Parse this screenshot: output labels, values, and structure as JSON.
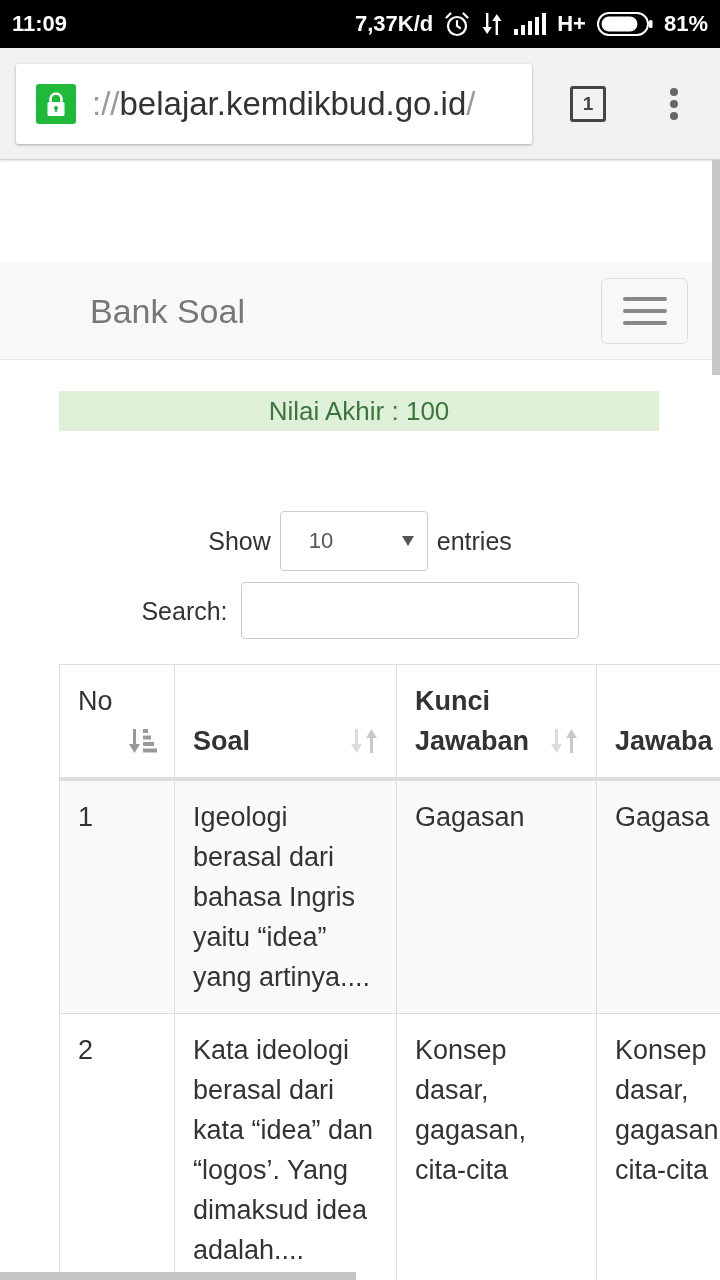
{
  "status_bar": {
    "time": "11:09",
    "network_speed": "7,37K/d",
    "network_type": "H+",
    "battery": "81%"
  },
  "browser": {
    "url": {
      "scheme": "://",
      "host": "belajar.kemdikbud.go.id",
      "path": "/"
    },
    "tab_count": "1"
  },
  "navbar": {
    "brand": "Bank Soal"
  },
  "alert": {
    "text": "Nilai Akhir : 100"
  },
  "length_menu": {
    "label_before": "Show",
    "value": "10",
    "label_after": "entries"
  },
  "search": {
    "label": "Search:"
  },
  "table": {
    "columns": [
      {
        "label": "No",
        "bold": false,
        "sortable": true,
        "sorted": true
      },
      {
        "label": "Soal",
        "bold": true,
        "sortable": true,
        "sorted": false
      },
      {
        "label": "Kunci Jawaban",
        "bold": true,
        "sortable": true,
        "sorted": false
      },
      {
        "label": "Jawaba",
        "bold": true
      }
    ],
    "rows": [
      [
        "1",
        "Igeologi berasal dari bahasa Ingris yaitu “idea” yang artinya....",
        "Gagasan",
        "Gagasa"
      ],
      [
        "2",
        "Kata ideologi berasal dari kata “idea” dan “logos’. Yang dimaksud idea adalah....",
        "Konsep dasar, gagasan, cita-cita",
        "Konsep dasar, gagasan cita-cita"
      ]
    ]
  }
}
